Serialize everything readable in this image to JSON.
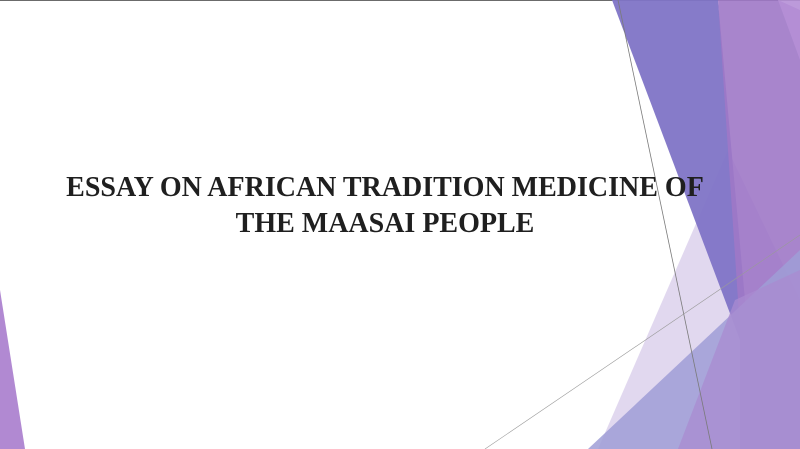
{
  "slide": {
    "title_lines": [
      "ESSAY ON AFRICAN TRADITION MEDICINE OF",
      "THE MAASAI PEOPLE"
    ]
  },
  "colors": {
    "background": "#ffffff",
    "title_text": "#1f1f1f",
    "accent_purple": "#9a7ac8",
    "accent_indigo": "#7b6fc4",
    "accent_lavender": "#c9b8e2",
    "accent_periwinkle": "#a7a3d8"
  },
  "icons": [
    "slide-decoration-shapes"
  ]
}
